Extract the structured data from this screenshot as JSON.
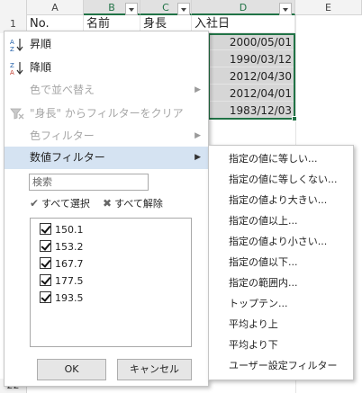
{
  "grid": {
    "columns": [
      "A",
      "B",
      "C",
      "D",
      "E"
    ],
    "row_number": "1",
    "bottom_row_number": "22",
    "header": {
      "a": "No.",
      "b": "名前",
      "c": "身長",
      "d": "入社日"
    },
    "dates": [
      "2000/05/01",
      "1990/03/12",
      "2012/04/30",
      "2012/04/01",
      "1983/12/03"
    ]
  },
  "filter_menu": {
    "sort_asc": "昇順",
    "sort_desc": "降順",
    "sort_by_color": "色で並べ替え",
    "clear_filter": "\"身長\" からフィルターをクリア",
    "color_filter": "色フィルター",
    "number_filter": "数値フィルター",
    "search_placeholder": "検索",
    "select_all": "すべて選択",
    "deselect_all": "すべて解除",
    "values": [
      "150.1",
      "153.2",
      "167.7",
      "177.5",
      "193.5"
    ],
    "ok": "OK",
    "cancel": "キャンセル"
  },
  "number_filter_submenu": [
    "指定の値に等しい...",
    "指定の値に等しくない...",
    "指定の値より大きい...",
    "指定の値以上...",
    "指定の値より小さい...",
    "指定の値以下...",
    "指定の範囲内...",
    "トップテン...",
    "平均より上",
    "平均より下",
    "ユーザー設定フィルター"
  ],
  "colors": {
    "selection": "#217346",
    "highlight": "#d5e3f2"
  }
}
